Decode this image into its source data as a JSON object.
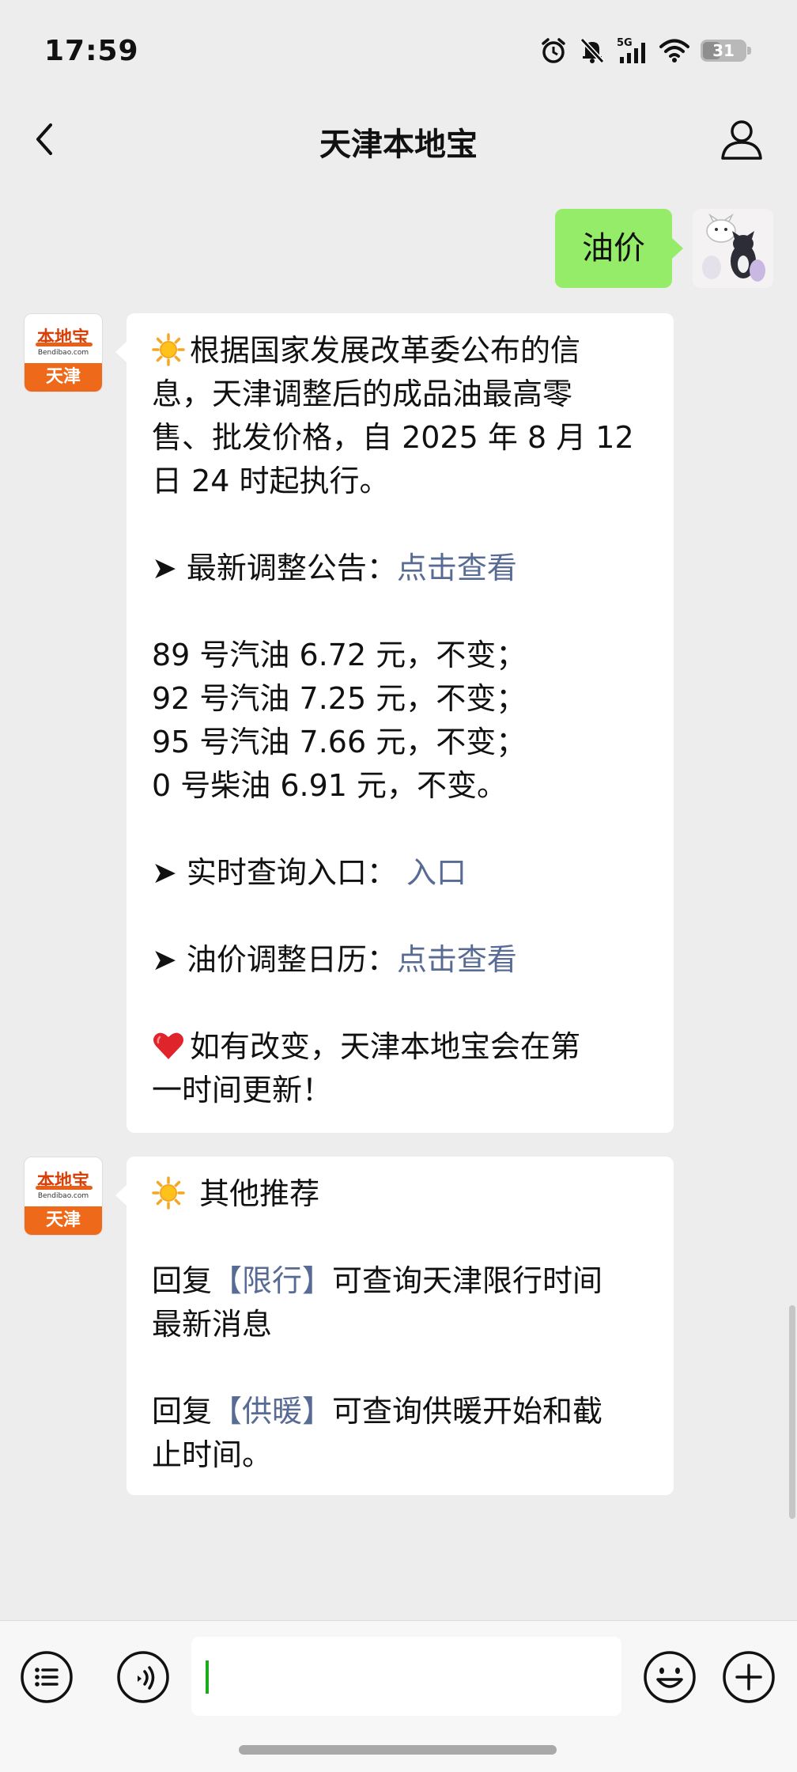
{
  "status_bar": {
    "time": "17:59",
    "network": "5G",
    "battery": "31"
  },
  "nav": {
    "title": "天津本地宝"
  },
  "user_message": {
    "text": "油价"
  },
  "brand_avatar": {
    "brand": "本地宝",
    "url": "Bendibao.com",
    "city": "天津"
  },
  "message1": {
    "line1": "根据国家发展改革委公布的信",
    "line2": "息，天津调整后的成品油最高零",
    "line3": "售、批发价格，自 2025 年 8 月 12",
    "line4": "日 24 时起执行。",
    "announce_label": "➤ 最新调整公告：",
    "announce_link": "点击查看",
    "price_89": "89 号汽油 6.72 元，不变；",
    "price_92": "92 号汽油 7.25 元，不变；",
    "price_95": "95 号汽油 7.66 元，不变；",
    "price_0": "0 号柴油 6.91 元，不变。",
    "query_label": "➤ 实时查询入口：",
    "query_link": "入口",
    "calendar_label": "➤ 油价调整日历：",
    "calendar_link": "点击查看",
    "footer_line1": "如有改变，天津本地宝会在第",
    "footer_line2": "一时间更新！"
  },
  "message2": {
    "title": "其他推荐",
    "reply1_prefix": "回复",
    "reply1_link": "【限行】",
    "reply1_suffix": "可查询天津限行时间",
    "reply1_line2": "最新消息",
    "reply2_prefix": "回复",
    "reply2_link": "【供暖】",
    "reply2_suffix": "可查询供暖开始和截",
    "reply2_line2": "止时间。"
  },
  "icons": {
    "back": "chevron-left-icon",
    "profile": "person-icon",
    "menu": "list-icon",
    "voice": "voice-icon",
    "emoji": "emoji-icon",
    "plus": "plus-icon",
    "sun": "sun-emoji",
    "heart": "heart-emoji"
  },
  "colors": {
    "background": "#ededed",
    "user_bubble": "#95ec69",
    "link": "#576b95",
    "brand_orange": "#ee6a1a"
  }
}
